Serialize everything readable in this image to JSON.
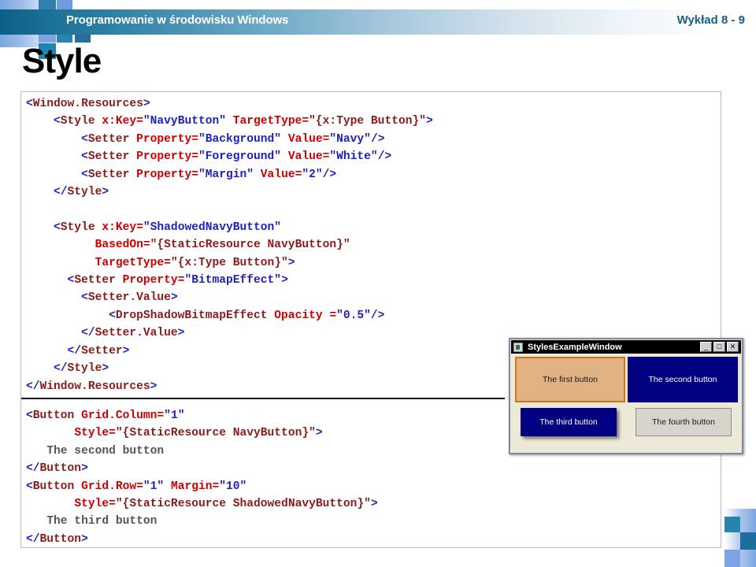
{
  "header": {
    "title": "Programowanie w środowisku Windows",
    "lecture": "Wykład 8 - 9",
    "accent_dark": "#0d5f86",
    "accent_text": "#1b5f86"
  },
  "slide": {
    "title": "Style"
  },
  "code_upper": {
    "lines": [
      [
        {
          "t": "<",
          "c": "br"
        },
        {
          "t": "Window.Resources",
          "c": "tg"
        },
        {
          "t": ">",
          "c": "br"
        }
      ],
      [
        {
          "t": "    <",
          "c": "br"
        },
        {
          "t": "Style ",
          "c": "tg"
        },
        {
          "t": "x:Key",
          "c": "at"
        },
        {
          "t": "=",
          "c": "at"
        },
        {
          "t": "\"NavyButton\"",
          "c": "vl"
        },
        {
          "t": " ",
          "c": "vl"
        },
        {
          "t": "TargetType",
          "c": "at"
        },
        {
          "t": "=",
          "c": "at"
        },
        {
          "t": "\"{x:Type Button}\"",
          "c": "tg"
        },
        {
          "t": ">",
          "c": "br"
        }
      ],
      [
        {
          "t": "        <",
          "c": "br"
        },
        {
          "t": "Setter ",
          "c": "tg"
        },
        {
          "t": "Property",
          "c": "at"
        },
        {
          "t": "=",
          "c": "at"
        },
        {
          "t": "\"Background\"",
          "c": "vl"
        },
        {
          "t": " ",
          "c": "vl"
        },
        {
          "t": "Value",
          "c": "at"
        },
        {
          "t": "=",
          "c": "at"
        },
        {
          "t": "\"Navy\"",
          "c": "vl"
        },
        {
          "t": "/>",
          "c": "br"
        }
      ],
      [
        {
          "t": "        <",
          "c": "br"
        },
        {
          "t": "Setter ",
          "c": "tg"
        },
        {
          "t": "Property",
          "c": "at"
        },
        {
          "t": "=",
          "c": "at"
        },
        {
          "t": "\"Foreground\"",
          "c": "vl"
        },
        {
          "t": " ",
          "c": "vl"
        },
        {
          "t": "Value",
          "c": "at"
        },
        {
          "t": "=",
          "c": "at"
        },
        {
          "t": "\"White\"",
          "c": "vl"
        },
        {
          "t": "/>",
          "c": "br"
        }
      ],
      [
        {
          "t": "        <",
          "c": "br"
        },
        {
          "t": "Setter ",
          "c": "tg"
        },
        {
          "t": "Property",
          "c": "at"
        },
        {
          "t": "=",
          "c": "at"
        },
        {
          "t": "\"Margin\"",
          "c": "vl"
        },
        {
          "t": " ",
          "c": "vl"
        },
        {
          "t": "Value",
          "c": "at"
        },
        {
          "t": "=",
          "c": "at"
        },
        {
          "t": "\"2\"",
          "c": "vl"
        },
        {
          "t": "/>",
          "c": "br"
        }
      ],
      [
        {
          "t": "    </",
          "c": "br"
        },
        {
          "t": "Style",
          "c": "tg"
        },
        {
          "t": ">",
          "c": "br"
        }
      ],
      [
        {
          "t": "",
          "c": "br"
        }
      ],
      [
        {
          "t": "    <",
          "c": "br"
        },
        {
          "t": "Style ",
          "c": "tg"
        },
        {
          "t": "x:Key",
          "c": "at"
        },
        {
          "t": "=",
          "c": "at"
        },
        {
          "t": "\"ShadowedNavyButton\"",
          "c": "vl"
        }
      ],
      [
        {
          "t": "          ",
          "c": "br"
        },
        {
          "t": "BasedOn",
          "c": "at"
        },
        {
          "t": "=",
          "c": "at"
        },
        {
          "t": "\"{StaticResource NavyButton}\"",
          "c": "tg"
        }
      ],
      [
        {
          "t": "          ",
          "c": "br"
        },
        {
          "t": "TargetType",
          "c": "at"
        },
        {
          "t": "=",
          "c": "at"
        },
        {
          "t": "\"{x:Type Button}\"",
          "c": "tg"
        },
        {
          "t": ">",
          "c": "br"
        }
      ],
      [
        {
          "t": "      <",
          "c": "br"
        },
        {
          "t": "Setter ",
          "c": "tg"
        },
        {
          "t": "Property",
          "c": "at"
        },
        {
          "t": "=",
          "c": "at"
        },
        {
          "t": "\"BitmapEffect\"",
          "c": "vl"
        },
        {
          "t": ">",
          "c": "br"
        }
      ],
      [
        {
          "t": "        <",
          "c": "br"
        },
        {
          "t": "Setter.Value",
          "c": "tg"
        },
        {
          "t": ">",
          "c": "br"
        }
      ],
      [
        {
          "t": "            <",
          "c": "br"
        },
        {
          "t": "DropShadowBitmapEffect ",
          "c": "tg"
        },
        {
          "t": "Opacity ",
          "c": "at"
        },
        {
          "t": "=",
          "c": "at"
        },
        {
          "t": "\"0.5\"",
          "c": "vl"
        },
        {
          "t": "/>",
          "c": "br"
        }
      ],
      [
        {
          "t": "        </",
          "c": "br"
        },
        {
          "t": "Setter.Value",
          "c": "tg"
        },
        {
          "t": ">",
          "c": "br"
        }
      ],
      [
        {
          "t": "      </",
          "c": "br"
        },
        {
          "t": "Setter",
          "c": "tg"
        },
        {
          "t": ">",
          "c": "br"
        }
      ],
      [
        {
          "t": "    </",
          "c": "br"
        },
        {
          "t": "Style",
          "c": "tg"
        },
        {
          "t": ">",
          "c": "br"
        }
      ],
      [
        {
          "t": "</",
          "c": "br"
        },
        {
          "t": "Window.Resources",
          "c": "tg"
        },
        {
          "t": ">",
          "c": "br"
        }
      ]
    ]
  },
  "code_lower": {
    "lines": [
      [
        {
          "t": "<",
          "c": "br"
        },
        {
          "t": "Button ",
          "c": "tg"
        },
        {
          "t": "Grid.Column",
          "c": "at"
        },
        {
          "t": "=",
          "c": "at"
        },
        {
          "t": "\"1\"",
          "c": "vl"
        }
      ],
      [
        {
          "t": "       ",
          "c": "br"
        },
        {
          "t": "Style",
          "c": "at"
        },
        {
          "t": "=",
          "c": "at"
        },
        {
          "t": "\"{StaticResource NavyButton}\"",
          "c": "tg"
        },
        {
          "t": ">",
          "c": "br"
        }
      ],
      [
        {
          "t": "   ",
          "c": "br"
        },
        {
          "t": "The second button",
          "c": "tx"
        }
      ],
      [
        {
          "t": "</",
          "c": "br"
        },
        {
          "t": "Button",
          "c": "tg"
        },
        {
          "t": ">",
          "c": "br"
        }
      ],
      [
        {
          "t": "<",
          "c": "br"
        },
        {
          "t": "Button ",
          "c": "tg"
        },
        {
          "t": "Grid.Row",
          "c": "at"
        },
        {
          "t": "=",
          "c": "at"
        },
        {
          "t": "\"1\"",
          "c": "vl"
        },
        {
          "t": " ",
          "c": "vl"
        },
        {
          "t": "Margin",
          "c": "at"
        },
        {
          "t": "=",
          "c": "at"
        },
        {
          "t": "\"10\"",
          "c": "vl"
        }
      ],
      [
        {
          "t": "       ",
          "c": "br"
        },
        {
          "t": "Style",
          "c": "at"
        },
        {
          "t": "=",
          "c": "at"
        },
        {
          "t": "\"{StaticResource ShadowedNavyButton}\"",
          "c": "tg"
        },
        {
          "t": ">",
          "c": "br"
        }
      ],
      [
        {
          "t": "   ",
          "c": "br"
        },
        {
          "t": "The third button",
          "c": "tx"
        }
      ],
      [
        {
          "t": "</",
          "c": "br"
        },
        {
          "t": "Button",
          "c": "tg"
        },
        {
          "t": ">",
          "c": "br"
        }
      ]
    ]
  },
  "window_screenshot": {
    "title": "StylesExampleWindow",
    "titlebar_icon": "application-icon",
    "controls": {
      "minimize": "_",
      "maximize": "□",
      "close": "✕"
    },
    "buttons": [
      {
        "label": "The first button",
        "background": "#e0b183",
        "foreground": "#1a1a1a"
      },
      {
        "label": "The second button",
        "background": "#000080",
        "foreground": "#ffffff"
      },
      {
        "label": "The third button",
        "background": "#000080",
        "foreground": "#ffffff"
      },
      {
        "label": "The fourth button",
        "background": "#d8d4cb",
        "foreground": "#1a1a1a"
      }
    ]
  }
}
